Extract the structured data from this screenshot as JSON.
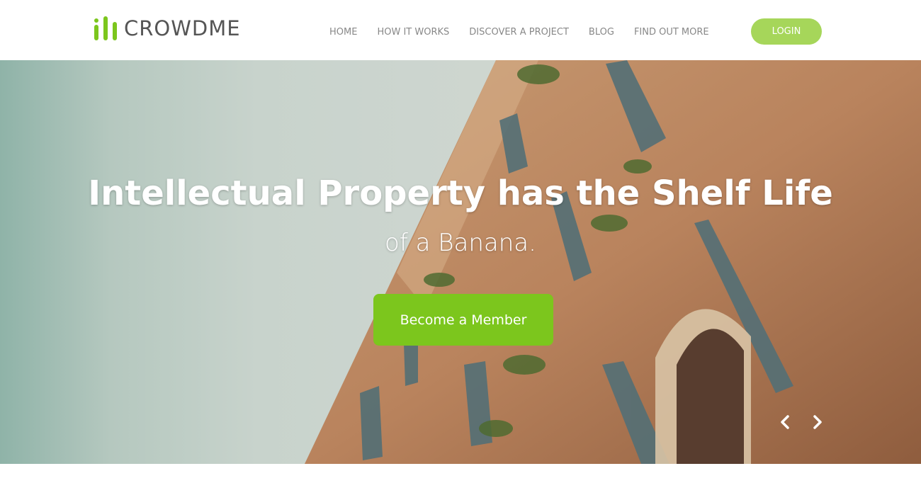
{
  "brand": {
    "name": "CROWDME",
    "accent": "#7cc61d",
    "login_color": "#a6d65a"
  },
  "nav": {
    "items": [
      {
        "label": "HOME"
      },
      {
        "label": "HOW IT WORKS"
      },
      {
        "label": "DISCOVER A PROJECT"
      },
      {
        "label": "BLOG"
      },
      {
        "label": "FIND OUT MORE"
      }
    ],
    "login_label": "LOGIN"
  },
  "hero": {
    "title": "Intellectual Property has the Shelf Life",
    "subtitle": "of a Banana.",
    "cta_label": "Become a Member",
    "prev_icon": "chevron-left-icon",
    "next_icon": "chevron-right-icon"
  }
}
